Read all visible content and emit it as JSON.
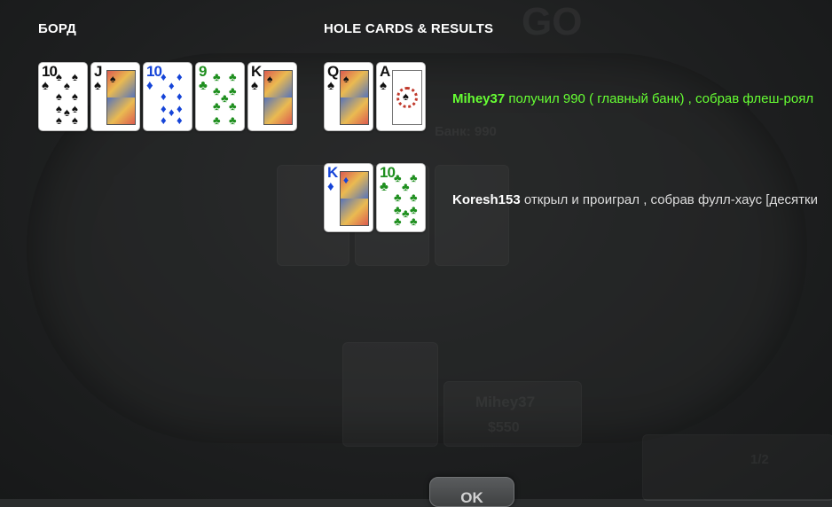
{
  "headings": {
    "board": "БОРД",
    "hole_cards": "HOLE CARDS & RESULTS"
  },
  "board": [
    {
      "rank": "10",
      "suit": "♠",
      "color": "black"
    },
    {
      "rank": "J",
      "suit": "♠",
      "color": "black"
    },
    {
      "rank": "10",
      "suit": "♦",
      "color": "blue"
    },
    {
      "rank": "9",
      "suit": "♣",
      "color": "green"
    },
    {
      "rank": "K",
      "suit": "♠",
      "color": "black"
    }
  ],
  "players": [
    {
      "cards": [
        {
          "rank": "Q",
          "suit": "♠",
          "color": "black"
        },
        {
          "rank": "A",
          "suit": "♠",
          "color": "black"
        }
      ],
      "name": "Mihey37",
      "message": "получил 990 ( главный банк) , собрав флеш-роял"
    },
    {
      "cards": [
        {
          "rank": "K",
          "suit": "♦",
          "color": "blue"
        },
        {
          "rank": "10",
          "suit": "♣",
          "color": "green"
        }
      ],
      "name": "Koresh153",
      "message": "открыл и проиграл , собрав фулл-хаус [десятки"
    }
  ],
  "ok_label": "OK",
  "background": {
    "logo": "GO",
    "seat_name": "Mihey37",
    "seat_stack": "$550",
    "bank": "Банк: 990",
    "blinds": "1/2"
  },
  "colors": {
    "win": "#66ff33",
    "black_suit": "#111111",
    "diamond_suit": "#1544d8",
    "club_suit": "#1f8f1f"
  }
}
